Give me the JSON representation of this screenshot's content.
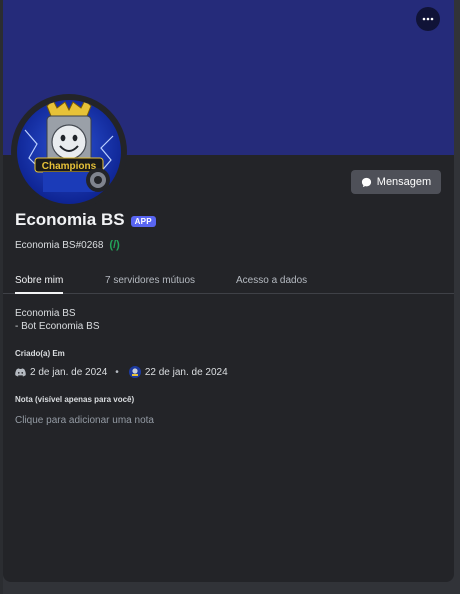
{
  "profile": {
    "display_name": "Economia BS",
    "badge": "APP",
    "username": "Economia BS#0268",
    "slash_indicator": "(/)",
    "message_button": "Mensagem",
    "avatar_text": "Champions",
    "status": "offline"
  },
  "tabs": [
    {
      "label": "Sobre mim",
      "active": true
    },
    {
      "label": "7 servidores mútuos",
      "active": false
    },
    {
      "label": "Acesso a dados",
      "active": false
    }
  ],
  "about": {
    "bio_line1": "Economia BS",
    "bio_line2": "- Bot Economia BS"
  },
  "created": {
    "title": "Criado(a) Em",
    "discord_date": "2 de jan. de 2024",
    "server_date": "22 de jan. de 2024"
  },
  "note": {
    "title": "Nota (visível apenas para você)",
    "placeholder": "Clique para adicionar uma nota"
  },
  "colors": {
    "banner": "#252b7a",
    "panel": "#232428",
    "accent": "#5865f2",
    "slash": "#23a55a"
  },
  "icons": {
    "more": "more-icon",
    "message": "chat-bubble-icon",
    "discord": "discord-icon",
    "server": "server-icon"
  }
}
